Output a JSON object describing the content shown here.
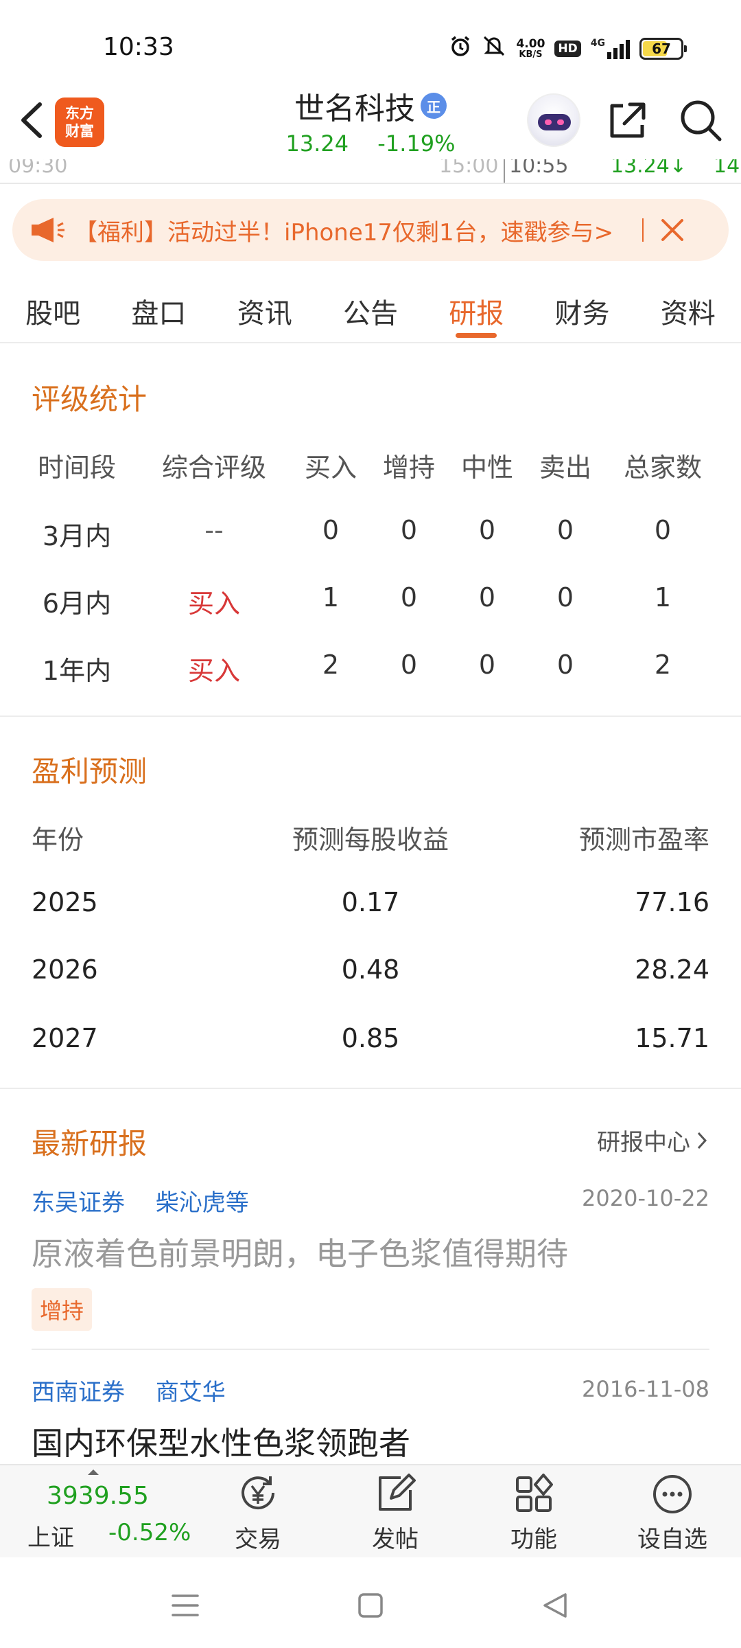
{
  "status_bar": {
    "time": "10:33",
    "net_speed_value": "4.00",
    "net_speed_unit": "KB/S",
    "hd_label": "HD",
    "network_label": "4G",
    "battery_level": 67,
    "battery_label": "67"
  },
  "header": {
    "logo_line1": "东方",
    "logo_line2": "财富",
    "stock_name": "世名科技",
    "badge_label": "正",
    "price": "13.24",
    "change_pct": "-1.19%",
    "price_color": "#20a020"
  },
  "chart_peek": {
    "time_start": "09:30",
    "time_end": "15:00",
    "cursor_time": "10:55",
    "cursor_price": "13.24↓",
    "cursor_extra": "14"
  },
  "banner": {
    "text": "【福利】活动过半！iPhone17仅剩1台，速戳参与>",
    "color": "#e8682c"
  },
  "tabs": [
    {
      "label": "股吧",
      "active": false
    },
    {
      "label": "盘口",
      "active": false
    },
    {
      "label": "资讯",
      "active": false
    },
    {
      "label": "公告",
      "active": false
    },
    {
      "label": "研报",
      "active": true
    },
    {
      "label": "财务",
      "active": false
    },
    {
      "label": "资料",
      "active": false
    }
  ],
  "rating_stats": {
    "title": "评级统计",
    "headers": [
      "时间段",
      "综合评级",
      "买入",
      "增持",
      "中性",
      "卖出",
      "总家数"
    ],
    "rows": [
      {
        "period": "3月内",
        "rating": "--",
        "buy": "0",
        "overweight": "0",
        "neutral": "0",
        "sell": "0",
        "total": "0"
      },
      {
        "period": "6月内",
        "rating": "买入",
        "buy": "1",
        "overweight": "0",
        "neutral": "0",
        "sell": "0",
        "total": "1"
      },
      {
        "period": "1年内",
        "rating": "买入",
        "buy": "2",
        "overweight": "0",
        "neutral": "0",
        "sell": "0",
        "total": "2"
      }
    ]
  },
  "earnings_forecast": {
    "title": "盈利预测",
    "headers": [
      "年份",
      "预测每股收益",
      "预测市盈率"
    ],
    "rows": [
      {
        "year": "2025",
        "eps": "0.17",
        "pe": "77.16"
      },
      {
        "year": "2026",
        "eps": "0.48",
        "pe": "28.24"
      },
      {
        "year": "2027",
        "eps": "0.85",
        "pe": "15.71"
      }
    ]
  },
  "latest_reports": {
    "title": "最新研报",
    "center_link": "研报中心",
    "items": [
      {
        "broker": "东吴证券",
        "analyst": "柴沁虎等",
        "date": "2020-10-22",
        "title": "原液着色前景明朗，电子色浆值得期待",
        "tag": "增持",
        "read": true
      },
      {
        "broker": "西南证券",
        "analyst": "商艾华",
        "date": "2016-11-08",
        "title": "国内环保型水性色浆领跑者",
        "read": false
      }
    ]
  },
  "bottom_bar": {
    "index_value": "3939.55",
    "index_name": "上证",
    "index_change": "-0.52%",
    "items": [
      {
        "label": "交易",
        "icon": "yen-refresh-icon"
      },
      {
        "label": "发帖",
        "icon": "edit-icon"
      },
      {
        "label": "功能",
        "icon": "grid-icon"
      },
      {
        "label": "设自选",
        "icon": "more-circle-icon"
      }
    ]
  }
}
